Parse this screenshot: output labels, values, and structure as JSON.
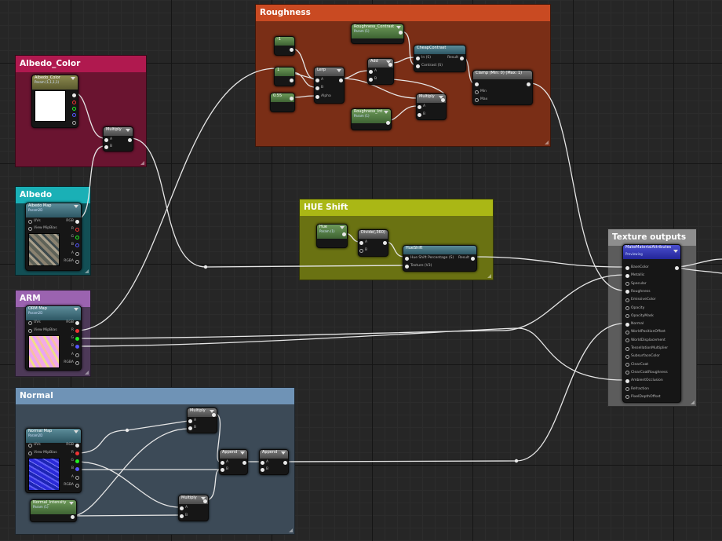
{
  "comments": {
    "albedo_color": "Albedo_Color",
    "albedo": "Albedo",
    "arm": "ARM",
    "normal": "Normal",
    "roughness": "Roughness",
    "hue_shift": "HUE Shift",
    "texture_outputs": "Texture outputs"
  },
  "nodes": {
    "albedo_color": {
      "title": "Albedo_Color",
      "sub": "Param (1,1,1,1)"
    },
    "multiply_albedo": {
      "title": "Multiply",
      "a": "A",
      "b": "B"
    },
    "albedo_map": {
      "title": "Albedo Map",
      "sub": "Param2D",
      "uvs": "UVs",
      "mip": "View MipBias",
      "rgb": "RGB",
      "r": "R",
      "g": "G",
      "b": "B",
      "a": "A",
      "rgba": "RGBA"
    },
    "orm_map": {
      "title": "ORM Map",
      "sub": "Param2D",
      "uvs": "UVs",
      "mip": "View MipBias",
      "rgb": "RGB",
      "r": "R",
      "g": "G",
      "b": "B",
      "a": "A",
      "rgba": "RGBA"
    },
    "normal_map": {
      "title": "Normal Map",
      "sub": "Param2D",
      "uvs": "UVs",
      "mip": "View MipBias",
      "rgb": "RGB",
      "r": "R",
      "g": "G",
      "b": "B",
      "a": "A",
      "rgba": "RGBA"
    },
    "normal_intensity": {
      "title": "Normal_Intensity",
      "sub": "Param (1)"
    },
    "multiply_n1": {
      "title": "Multiply",
      "a": "A",
      "b": "B"
    },
    "multiply_n2": {
      "title": "Multiply",
      "a": "A",
      "b": "B"
    },
    "append1": {
      "title": "Append",
      "a": "A",
      "b": "B"
    },
    "append2": {
      "title": "Append",
      "a": "A",
      "b": "B"
    },
    "const_neg1": {
      "title": "-1"
    },
    "const_1": {
      "title": "1"
    },
    "const_05": {
      "title": "0.55"
    },
    "lerp": {
      "title": "Lerp",
      "a": "A",
      "b": "B",
      "alpha": "Alpha"
    },
    "add": {
      "title": "Add",
      "a": "A",
      "b": "B"
    },
    "roughness_contrast": {
      "title": "Roughness_Contrast",
      "sub": "Param (1)"
    },
    "cheap_contrast": {
      "title": "CheapContrast",
      "in": "In (S)",
      "result": "Result",
      "contrast": "Contrast (S)"
    },
    "clamp": {
      "title": "Clamp (Min: 0) (Max: 1)",
      "min": "Min",
      "max": "Max"
    },
    "roughness_int": {
      "title": "Roughness_Int",
      "sub": "Param (1)"
    },
    "multiply_r": {
      "title": "Multiply",
      "a": "A",
      "b": "B"
    },
    "hue": {
      "title": "Hue",
      "sub": "Param (1)"
    },
    "divide": {
      "title": "Divide(,360)",
      "a": "A",
      "b": "B"
    },
    "hueshift": {
      "title": "HueShift",
      "pct": "Hue Shift Percentage (S)",
      "result": "Result",
      "texture": "Texture (V3)"
    },
    "make_material": {
      "title": "MakeMaterialAttributes",
      "sub": "Previewing",
      "pins": [
        "BaseColor",
        "Metallic",
        "Specular",
        "Roughness",
        "EmissiveColor",
        "Opacity",
        "OpacityMask",
        "Normal",
        "WorldPositionOffset",
        "WorldDisplacement",
        "TessellationMultiplier",
        "SubsurfaceColor",
        "ClearCoat",
        "ClearCoatRoughness",
        "AmbientOcclusion",
        "Refraction",
        "PixelDepthOffset"
      ]
    }
  },
  "colors": {
    "albedo_color": "#a8154e",
    "albedo": "#1ab0b6",
    "arm": "#a066b5",
    "normal": "#6f93b6",
    "roughness": "#c94a22",
    "hue_shift": "#aab715",
    "texture_outputs": "#8e8e8e"
  }
}
